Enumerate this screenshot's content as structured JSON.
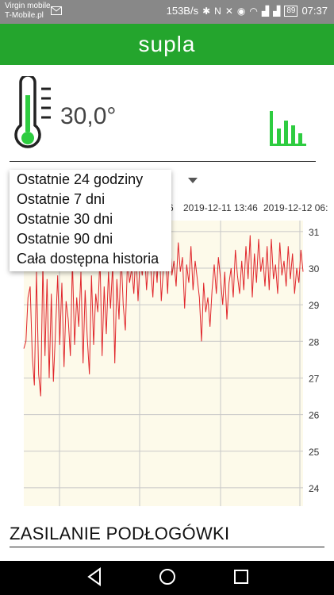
{
  "status_bar": {
    "carrier_line1": "Virgin mobile",
    "carrier_line2": "T-Mobile.pl",
    "net_speed": "153B/s",
    "battery": "89",
    "time": "07:37"
  },
  "app_bar": {
    "title": "supla"
  },
  "sensor": {
    "temperature": "30,0°"
  },
  "range_menu": {
    "options": [
      "Ostatnie 24 godziny",
      "Ostatnie 7 dni",
      "Ostatnie 30 dni",
      "Ostatnie 90 dni",
      "Cała dostępna historia"
    ]
  },
  "chart_data": {
    "type": "line",
    "x_tick_labels": [
      "6",
      "2019-12-11 13:46",
      "2019-12-12 06:"
    ],
    "y_ticks": [
      24,
      25,
      26,
      27,
      28,
      29,
      30,
      31
    ],
    "ylim": [
      23.5,
      31.3
    ],
    "grid": true,
    "series": [
      {
        "values": [
          27.8,
          28.0,
          29.2,
          29.5,
          27.6,
          26.8,
          29.9,
          27.1,
          26.5,
          30.1,
          27.6,
          29.7,
          27.0,
          29.3,
          26.9,
          28.3,
          29.8,
          27.9,
          29.6,
          27.3,
          29.1,
          28.6,
          27.6,
          30.2,
          27.9,
          29.2,
          28.4,
          29.9,
          27.4,
          29.4,
          28.1,
          27.1,
          29.8,
          27.9,
          29.3,
          28.8,
          30.3,
          27.6,
          29.5,
          28.2,
          29.9,
          28.9,
          30.1,
          27.4,
          29.7,
          28.6,
          30.4,
          29.0,
          28.3,
          30.2,
          29.6,
          30.0,
          29.3,
          30.5,
          29.1,
          30.3,
          29.8,
          30.6,
          29.4,
          30.2,
          30.0,
          29.2,
          30.5,
          29.6,
          30.8,
          29.1,
          30.0,
          30.4,
          29.3,
          30.9,
          29.8,
          30.2,
          29.5,
          30.7,
          29.9,
          30.3,
          28.9,
          30.1,
          29.6,
          30.6,
          29.4,
          30.2,
          29.7,
          29.2,
          28.0,
          29.6,
          28.8,
          29.2,
          28.4,
          29.4,
          30.1,
          29.3,
          30.3,
          29.7,
          29.0,
          29.9,
          28.6,
          29.6,
          30.0,
          29.2,
          30.5,
          29.8,
          29.3,
          30.2,
          29.4,
          30.6,
          29.7,
          30.9,
          29.2,
          30.4,
          29.6,
          30.8,
          29.9,
          30.3,
          29.5,
          30.6,
          29.4,
          30.8,
          29.7,
          30.1,
          29.3,
          30.7,
          29.8,
          30.2,
          29.5,
          30.6,
          29.7,
          30.4,
          29.3,
          30.0,
          29.6,
          30.5,
          29.9
        ]
      }
    ]
  },
  "section": {
    "title": "ZASILANIE PODŁOGÓWKI"
  },
  "colors": {
    "appbar": "#24a52d",
    "accent": "#2ecc40",
    "line": "#e0262b",
    "plot_bg": "#fdfaea"
  }
}
